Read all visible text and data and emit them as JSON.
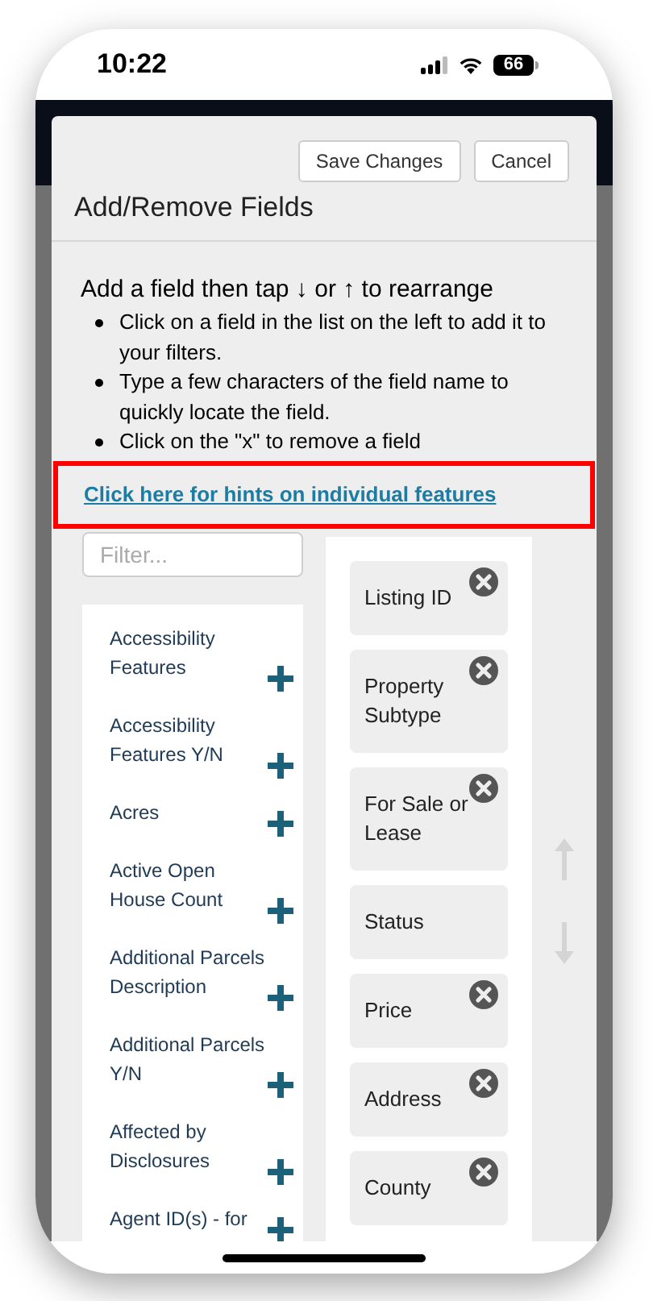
{
  "status_bar": {
    "time": "10:22",
    "battery": "66"
  },
  "dialog": {
    "title": "Add/Remove Fields",
    "buttons": [
      {
        "label": "Save Changes"
      },
      {
        "label": "Cancel"
      }
    ]
  },
  "instructions": {
    "heading": "Add a field then tap ↓ or ↑ to rearrange",
    "bullets": [
      "Click on a field in the list on the left to add it to your filters.",
      "Type a few characters of the field name to quickly locate the field.",
      "Click on the \"x\" to remove a field"
    ]
  },
  "hint_link": {
    "label": "Click here for hints on individual features",
    "highlighted": true
  },
  "filter": {
    "placeholder": "Filter..."
  },
  "available_fields": [
    {
      "label": "Accessibility Features"
    },
    {
      "label": "Accessibility Features Y/N"
    },
    {
      "label": "Acres"
    },
    {
      "label": "Active Open House Count"
    },
    {
      "label": "Additional Parcels Description"
    },
    {
      "label": "Additional Parcels Y/N"
    },
    {
      "label": "Affected by Disclosures"
    },
    {
      "label": "Agent ID(s) - for"
    }
  ],
  "selected_fields": [
    {
      "label": "Listing ID",
      "removable": true
    },
    {
      "label": "Property Subtype",
      "removable": true
    },
    {
      "label": "For Sale or Lease",
      "removable": true
    },
    {
      "label": "Status",
      "removable": false
    },
    {
      "label": "Price",
      "removable": true
    },
    {
      "label": "Address",
      "removable": true
    },
    {
      "label": "County",
      "removable": true
    }
  ]
}
